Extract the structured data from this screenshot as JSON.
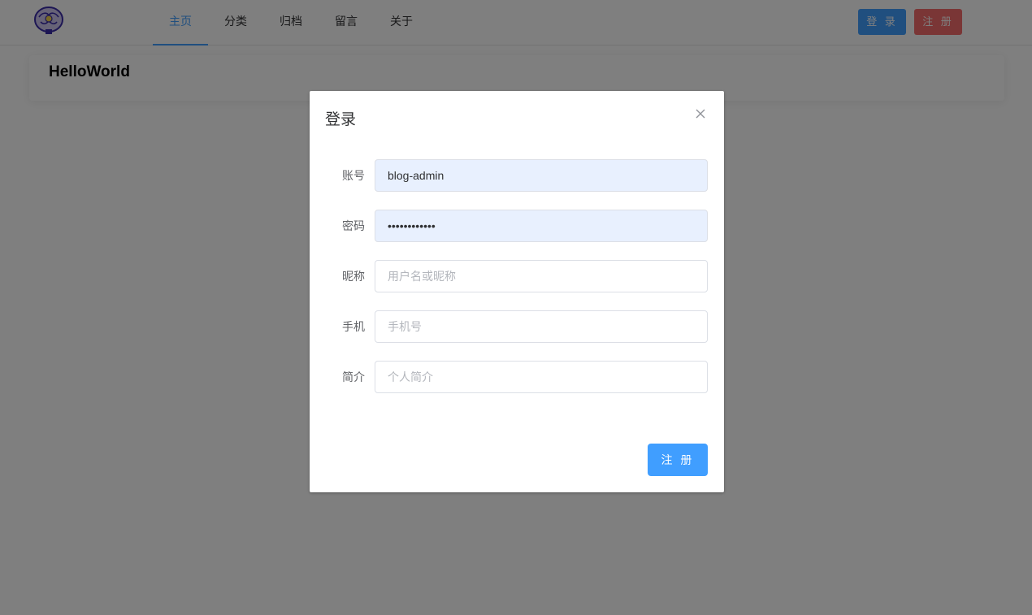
{
  "header": {
    "logo": "brain-logo",
    "nav": [
      {
        "label": "主页",
        "active": true
      },
      {
        "label": "分类"
      },
      {
        "label": "归档"
      },
      {
        "label": "留言"
      },
      {
        "label": "关于"
      }
    ],
    "login_label": "登 录",
    "register_label": "注 册"
  },
  "main": {
    "card_title": "HelloWorld"
  },
  "dialog": {
    "title": "登录",
    "close_icon": "close-icon",
    "fields": [
      {
        "label": "账号",
        "value": "blog-admin",
        "placeholder": ""
      },
      {
        "label": "密码",
        "value": "password1234",
        "placeholder": "",
        "type": "password"
      },
      {
        "label": "昵称",
        "value": "",
        "placeholder": "用户名或昵称"
      },
      {
        "label": "手机",
        "value": "",
        "placeholder": "手机号"
      },
      {
        "label": "简介",
        "value": "",
        "placeholder": "个人简介"
      }
    ],
    "submit_label": "注 册"
  },
  "colors": {
    "primary": "#409eff",
    "danger": "#f56c6c",
    "autofill": "#e8f0fe"
  }
}
